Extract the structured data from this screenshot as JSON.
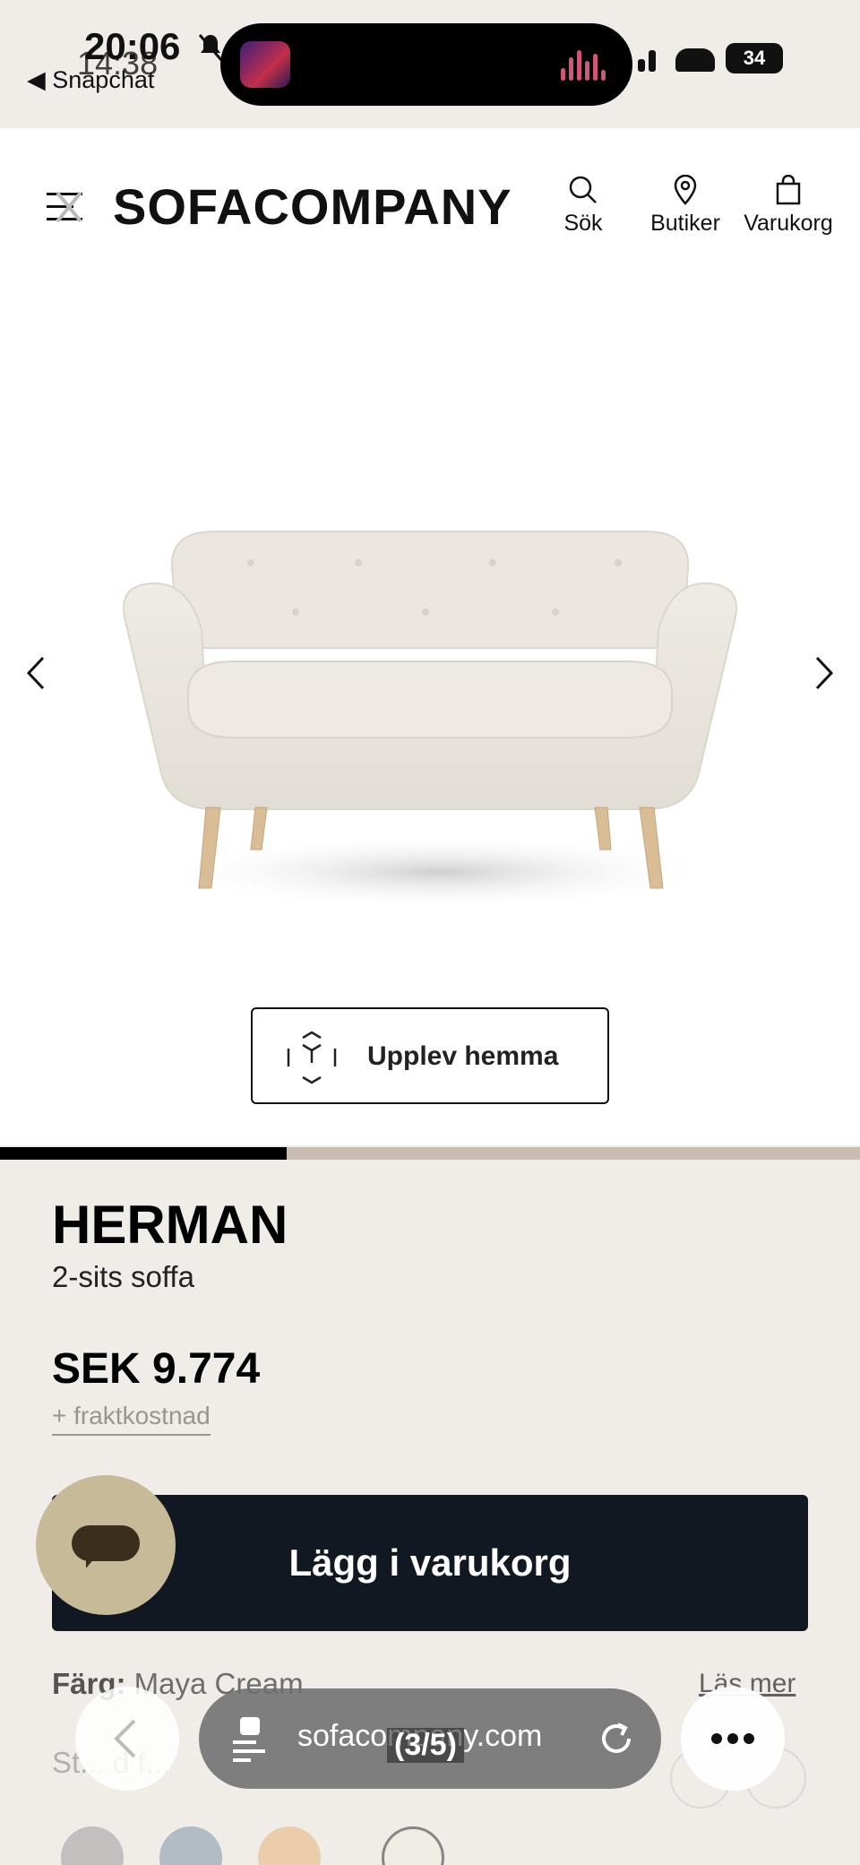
{
  "status_bar": {
    "time_primary": "20:06",
    "time_secondary": "14:38",
    "back_app": "Snapchat",
    "battery": "34"
  },
  "header": {
    "logo": "SOFACOMPANY",
    "search_label": "Sök",
    "stores_label": "Butiker",
    "cart_label": "Varukorg"
  },
  "gallery": {
    "ar_button_label": "Upplev hemma",
    "progress_fraction": 0.333
  },
  "product": {
    "name": "HERMAN",
    "type": "2-sits soffa",
    "price": "SEK 9.774",
    "shipping": "+ fraktkostnad",
    "add_to_cart": "Lägg i varukorg",
    "color_label": "Färg:",
    "color_value": "Maya Cream",
    "read_more": "Läs mer",
    "standard_partial": "St... d f..."
  },
  "browser": {
    "url": "sofacompany.com",
    "tab_counter": "(3/5)"
  },
  "colors": {
    "header_bg": "#ffffff",
    "page_bg": "#f0ede8",
    "cart_button": "#111821",
    "chat_button": "#c7ba98",
    "progress_track": "#c8bcb3"
  }
}
